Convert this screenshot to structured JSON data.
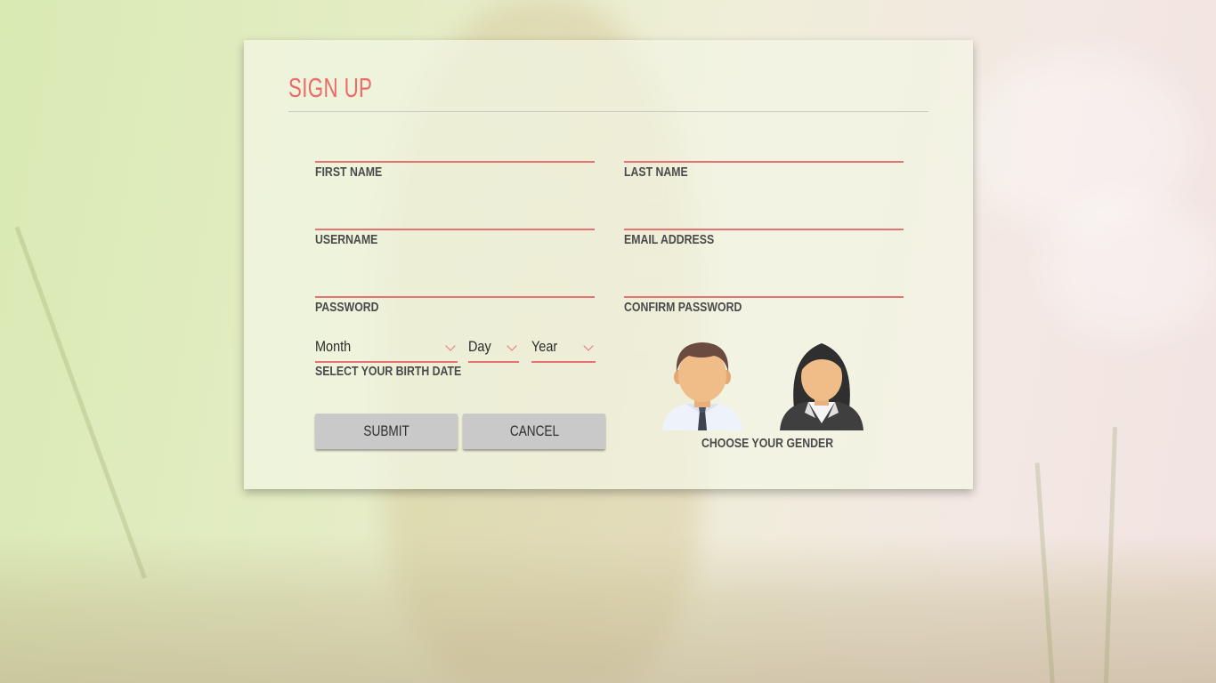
{
  "form": {
    "title": "SIGN UP",
    "fields": {
      "first_name": {
        "label": "FIRST NAME",
        "value": ""
      },
      "last_name": {
        "label": "LAST NAME",
        "value": ""
      },
      "username": {
        "label": "USERNAME",
        "value": ""
      },
      "email": {
        "label": "EMAIL ADDRESS",
        "value": ""
      },
      "password": {
        "label": "PASSWORD",
        "value": ""
      },
      "confirm_password": {
        "label": "CONFIRM PASSWORD",
        "value": ""
      }
    },
    "birth_date": {
      "month": "Month",
      "day": "Day",
      "year": "Year",
      "label": "SELECT YOUR BIRTH DATE"
    },
    "gender": {
      "label": "CHOOSE YOUR GENDER",
      "options": [
        "male-avatar-icon",
        "female-avatar-icon"
      ]
    },
    "buttons": {
      "submit": "SUBMIT",
      "cancel": "CANCEL"
    }
  },
  "colors": {
    "accent": "#ee6a6a",
    "underline": "#e57373",
    "label": "#4a4a4a",
    "button": "#c9c9c9"
  }
}
